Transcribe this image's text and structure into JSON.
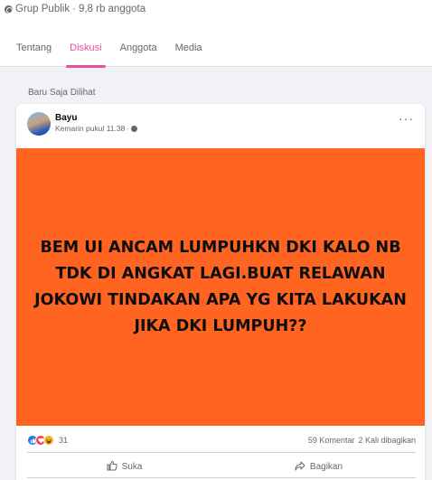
{
  "group": {
    "privacy": "Grup Publik",
    "separator": "·",
    "members": "9,8 rb anggota"
  },
  "tabs": [
    {
      "label": "Tentang",
      "active": false
    },
    {
      "label": "Diskusi",
      "active": true
    },
    {
      "label": "Anggota",
      "active": false
    },
    {
      "label": "Media",
      "active": false
    }
  ],
  "colors": {
    "accent": "#e94f9c",
    "post_background": "#ff6521"
  },
  "section": {
    "title": "Baru Saja Dilihat"
  },
  "post": {
    "author": "Bayu",
    "timestamp": "Kemarin pukul 11.38",
    "timestamp_separator": "·",
    "text": "BEM UI ANCAM LUMPUHKN DKI KALO NB TDK DI ANGKAT LAGI.BUAT RELAWAN JOKOWI TINDAKAN APA YG KITA LAKUKAN JIKA DKI LUMPUH??",
    "reaction_icons": [
      "like-icon",
      "love-icon",
      "haha-icon"
    ],
    "reaction_count": "31",
    "comments": "59 Komentar",
    "shares": "2 Kali dibagikan",
    "actions": {
      "like": "Suka",
      "share": "Bagikan"
    }
  }
}
